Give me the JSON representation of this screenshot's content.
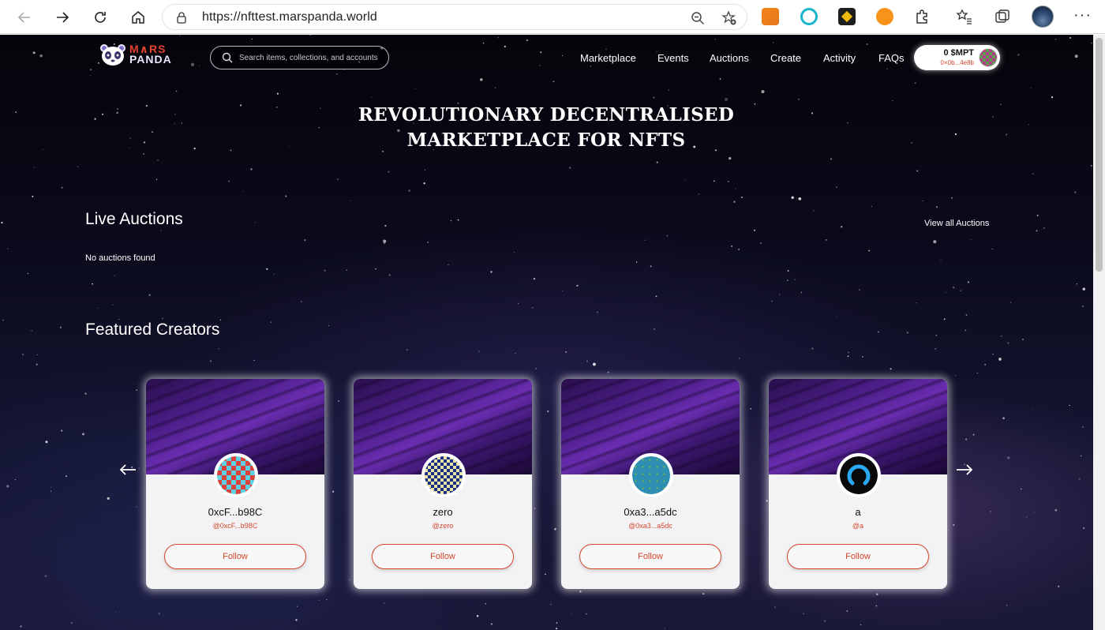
{
  "browser": {
    "url": "https://nfttest.marspanda.world",
    "extensions": [
      "metamask-icon",
      "edge-copilot-icon",
      "binance-icon",
      "p-coin-icon",
      "extensions-puzzle-icon"
    ],
    "menu_label": "···"
  },
  "site": {
    "logo_top": "M∧RS",
    "logo_bottom": "PANDA",
    "search_placeholder": "Search items, collections, and accounts",
    "nav": [
      "Marketplace",
      "Events",
      "Auctions",
      "Create",
      "Activity",
      "FAQs"
    ],
    "wallet": {
      "amount": "0 $MPT",
      "address": "0×0b...4e8b"
    }
  },
  "hero": {
    "line1": "REVOLUTIONARY DECENTRALISED",
    "line2": "MARKETPLACE FOR NFTS"
  },
  "live_auctions": {
    "title": "Live Auctions",
    "view_all": "View all Auctions",
    "empty": "No auctions found"
  },
  "featured_creators": {
    "title": "Featured Creators",
    "prev_arrow": "←",
    "next_arrow": "→",
    "cards": [
      {
        "name": "0xcF...b98C",
        "handle": "@0xcF...b98C",
        "follow": "Follow"
      },
      {
        "name": "zero",
        "handle": "@zero",
        "follow": "Follow"
      },
      {
        "name": "0xa3...a5dc",
        "handle": "@0xa3...a5dc",
        "follow": "Follow"
      },
      {
        "name": "a",
        "handle": "@a",
        "follow": "Follow"
      }
    ]
  },
  "colors": {
    "accent": "#d2462c",
    "card_bg": "#f3f3f5",
    "logo_red": "#e2412c"
  }
}
